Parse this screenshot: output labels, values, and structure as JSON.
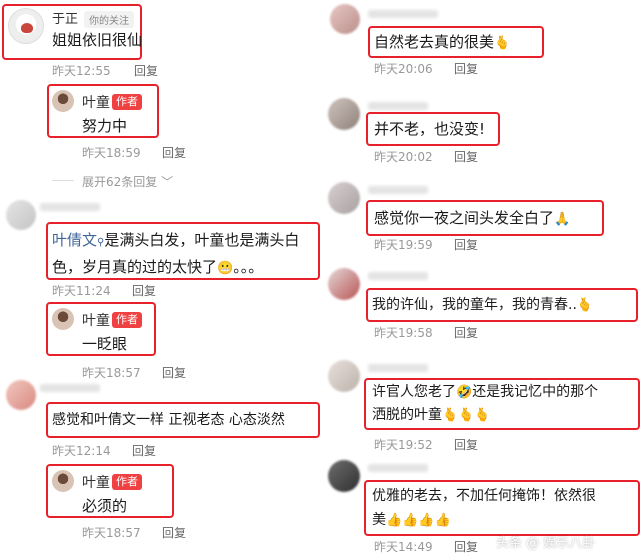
{
  "left": {
    "c1": {
      "user": "于正",
      "follow_tag": "你的关注",
      "text": "姐姐依旧很仙",
      "time": "昨天12:55",
      "reply": "回复"
    },
    "r1": {
      "user": "叶童",
      "author_tag": "作者",
      "text": "努力中",
      "time": "昨天18:59",
      "reply": "回复"
    },
    "expand": "展开62条回复",
    "c2": {
      "mention": "叶倩文",
      "text_line1": "是满头白发，叶童也是满头白",
      "text_line2": "色，岁月真的过的太快了",
      "tail": "。。。",
      "time": "昨天11:24",
      "reply": "回复"
    },
    "r2": {
      "user": "叶童",
      "author_tag": "作者",
      "text": "一眨眼",
      "time": "昨天18:57",
      "reply": "回复"
    },
    "c3": {
      "text": "感觉和叶倩文一样 正视老态 心态淡然",
      "time": "昨天12:14",
      "reply": "回复"
    },
    "r3": {
      "user": "叶童",
      "author_tag": "作者",
      "text": "必须的",
      "time": "昨天18:57",
      "reply": "回复"
    }
  },
  "right": {
    "c1": {
      "text": "自然老去真的很美",
      "emoji": "🫰",
      "time": "昨天20:06",
      "reply": "回复"
    },
    "c2": {
      "text": "并不老，也没变!",
      "time": "昨天20:02",
      "reply": "回复"
    },
    "c3": {
      "text": "感觉你一夜之间头发全白了",
      "emoji": "🙏",
      "time": "昨天19:59",
      "reply": "回复"
    },
    "c4": {
      "text": "我的许仙，我的童年，我的青春..",
      "emoji": "🫰",
      "time": "昨天19:58",
      "reply": "回复"
    },
    "c5": {
      "text_line1": "许官人您老了",
      "emoji1": "🤣",
      "text_line1b": "还是我记忆中的那个",
      "text_line2": "洒脱的叶童",
      "emoji2": "🫰🫰🫰",
      "time": "昨天19:52",
      "reply": "回复"
    },
    "c6": {
      "text_line1": "优雅的老去，不加任何掩饰！依然很",
      "text_line2": "美",
      "emoji": "👍👍👍👍",
      "time": "昨天14:49",
      "reply": "回复"
    }
  },
  "watermark": "头条 @ 娱乐八卦"
}
